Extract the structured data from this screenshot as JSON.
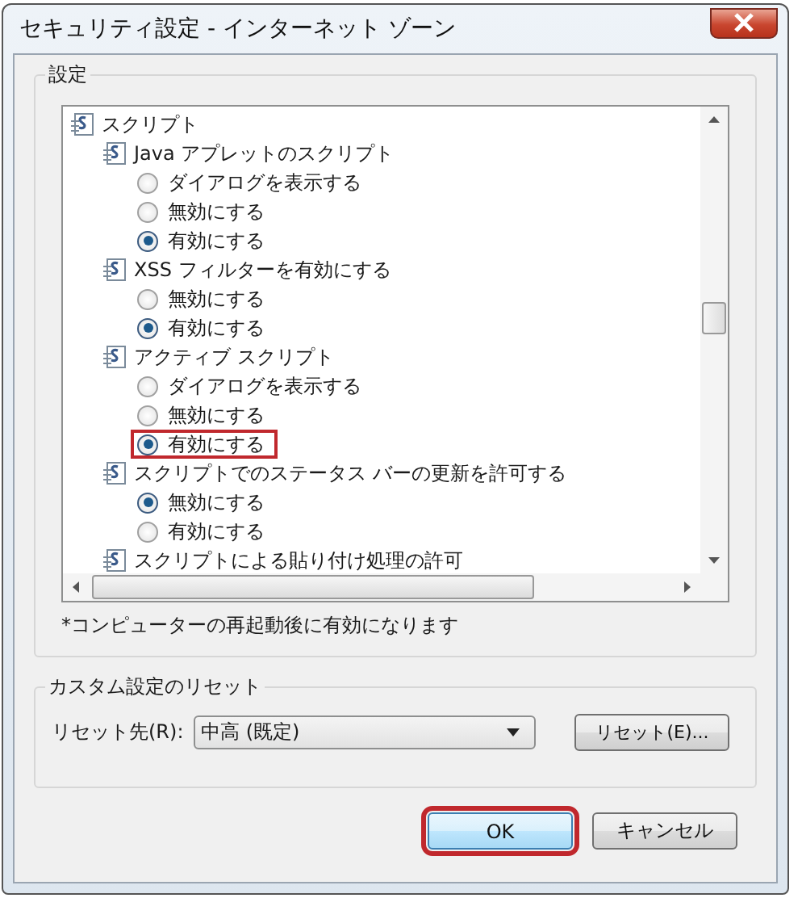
{
  "window": {
    "title": "セキュリティ設定 - インターネット ゾーン"
  },
  "settings": {
    "label": "設定",
    "tree": [
      {
        "label": "スクリプト",
        "children": [
          {
            "label": "Java アプレットのスクリプト",
            "options": [
              {
                "label": "ダイアログを表示する",
                "selected": false,
                "highlighted": false
              },
              {
                "label": "無効にする",
                "selected": false,
                "highlighted": false
              },
              {
                "label": "有効にする",
                "selected": true,
                "highlighted": false
              }
            ]
          },
          {
            "label": "XSS フィルターを有効にする",
            "options": [
              {
                "label": "無効にする",
                "selected": false,
                "highlighted": false
              },
              {
                "label": "有効にする",
                "selected": true,
                "highlighted": false
              }
            ]
          },
          {
            "label": "アクティブ スクリプト",
            "options": [
              {
                "label": "ダイアログを表示する",
                "selected": false,
                "highlighted": false
              },
              {
                "label": "無効にする",
                "selected": false,
                "highlighted": false
              },
              {
                "label": "有効にする",
                "selected": true,
                "highlighted": true
              }
            ]
          },
          {
            "label": "スクリプトでのステータス バーの更新を許可する",
            "options": [
              {
                "label": "無効にする",
                "selected": true,
                "highlighted": false
              },
              {
                "label": "有効にする",
                "selected": false,
                "highlighted": false
              }
            ]
          },
          {
            "label": "スクリプトによる貼り付け処理の許可"
          }
        ]
      }
    ],
    "note": "*コンピューターの再起動後に有効になります"
  },
  "reset": {
    "label": "カスタム設定のリセット",
    "target_label": "リセット先(R):",
    "target_value": "中高 (既定)",
    "button": "リセット(E)..."
  },
  "buttons": [
    {
      "label": "OK",
      "highlighted": true
    },
    {
      "label": "キャンセル",
      "highlighted": false
    }
  ]
}
